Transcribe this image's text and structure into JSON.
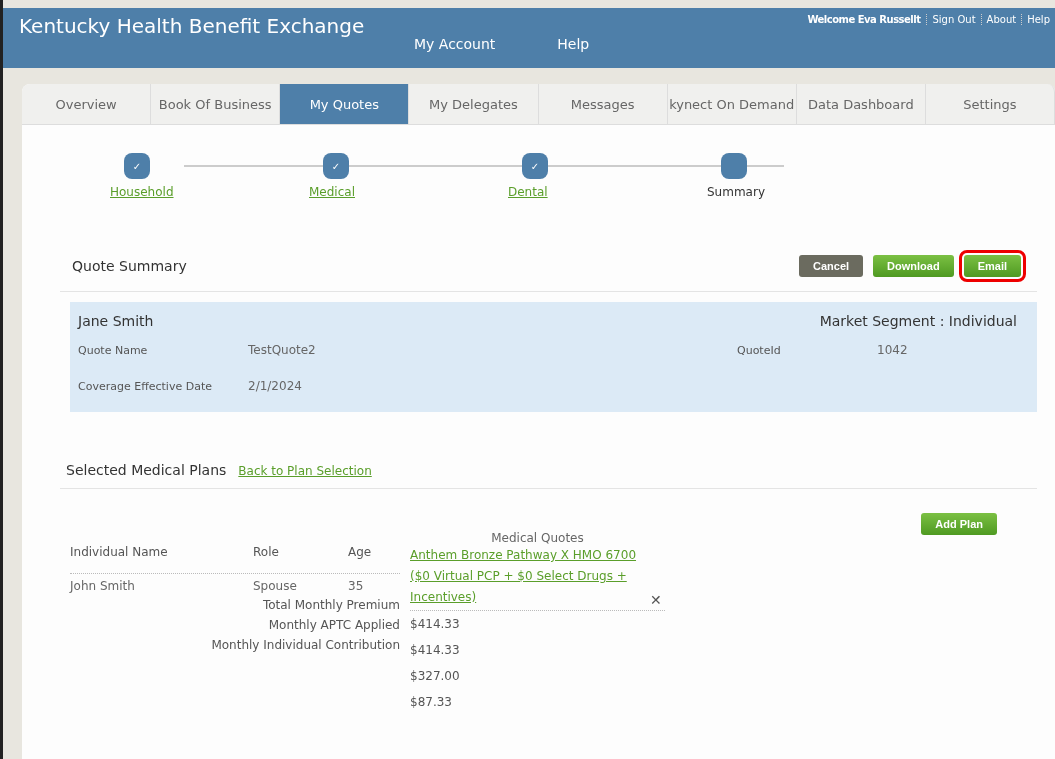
{
  "header": {
    "title": "Kentucky Health Benefit Exchange",
    "nav": [
      "My Account",
      "Help"
    ],
    "welcome": "Welcome Eva Russellt",
    "links": [
      "Sign Out",
      "About",
      "Help"
    ]
  },
  "tabs": [
    {
      "label": "Overview",
      "selected": false
    },
    {
      "label": "Book Of Business",
      "selected": false
    },
    {
      "label": "My Quotes",
      "selected": true
    },
    {
      "label": "My Delegates",
      "selected": false
    },
    {
      "label": "Messages",
      "selected": false
    },
    {
      "label": "kynect On Demand",
      "selected": false
    },
    {
      "label": "Data Dashboard",
      "selected": false
    },
    {
      "label": "Settings",
      "selected": false
    }
  ],
  "steps": [
    {
      "label": "Household",
      "done": true,
      "icon": "✓"
    },
    {
      "label": "Medical",
      "done": true,
      "icon": "✓"
    },
    {
      "label": "Dental",
      "done": true,
      "icon": "✓"
    },
    {
      "label": "Summary",
      "done": false
    }
  ],
  "summary": {
    "title": "Quote Summary",
    "buttons": [
      {
        "label": "Cancel",
        "kind": "cancel",
        "highlighted": false
      },
      {
        "label": "Download",
        "kind": "primary",
        "highlighted": false
      },
      {
        "label": "Email",
        "kind": "primary",
        "highlighted": true
      }
    ]
  },
  "quote": {
    "name": "Jane Smith",
    "segment": "Market Segment : Individual",
    "quote_name_label": "Quote Name",
    "quote_name": "TestQuote2",
    "quote_id_label": "QuoteId",
    "quote_id": "1042",
    "date_label": "Coverage Effective Date",
    "date": "2/1/2024"
  },
  "plans": {
    "title": "Selected Medical Plans",
    "back_link": "Back to Plan Selection",
    "add_button": "Add Plan",
    "columns": [
      "Individual Name",
      "Role",
      "Age",
      "Medical Quotes"
    ],
    "plan_link": "Anthem Bronze Pathway X HMO 6700 ($0 Virtual PCP + $0 Select Drugs + Incentives)",
    "remove_icon": "✕",
    "rows": [
      {
        "name": "John Smith",
        "role": "Spouse",
        "age": "35"
      }
    ],
    "total_labels": [
      "Total Monthly Premium",
      "Monthly APTC Applied",
      "Monthly Individual Contribution"
    ],
    "values": [
      "$414.33",
      "$414.33",
      "$327.00",
      "$87.33"
    ]
  }
}
